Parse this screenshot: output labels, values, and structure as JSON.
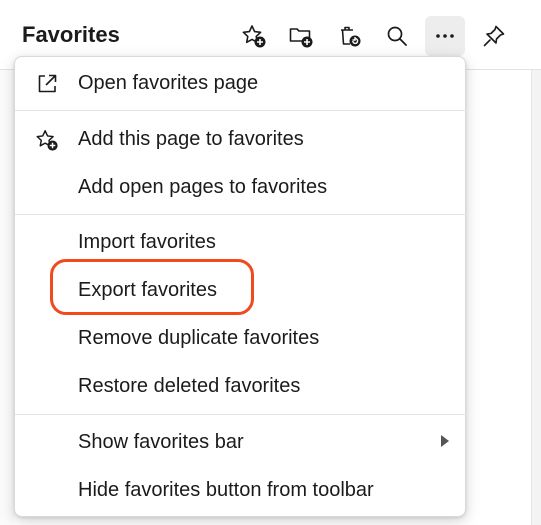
{
  "header": {
    "title": "Favorites"
  },
  "toolbar": {
    "icons": [
      "add-favorite-icon",
      "add-folder-icon",
      "restore-icon",
      "search-icon",
      "more-icon",
      "pin-icon"
    ]
  },
  "menu": {
    "items": [
      {
        "label": "Open favorites page"
      },
      {
        "label": "Add this page to favorites"
      },
      {
        "label": "Add open pages to favorites"
      },
      {
        "label": "Import favorites"
      },
      {
        "label": "Export favorites"
      },
      {
        "label": "Remove duplicate favorites"
      },
      {
        "label": "Restore deleted favorites"
      },
      {
        "label": "Show favorites bar"
      },
      {
        "label": "Hide favorites button from toolbar"
      }
    ]
  },
  "colors": {
    "highlight": "#f04a1e",
    "text": "#1b1b1b"
  }
}
